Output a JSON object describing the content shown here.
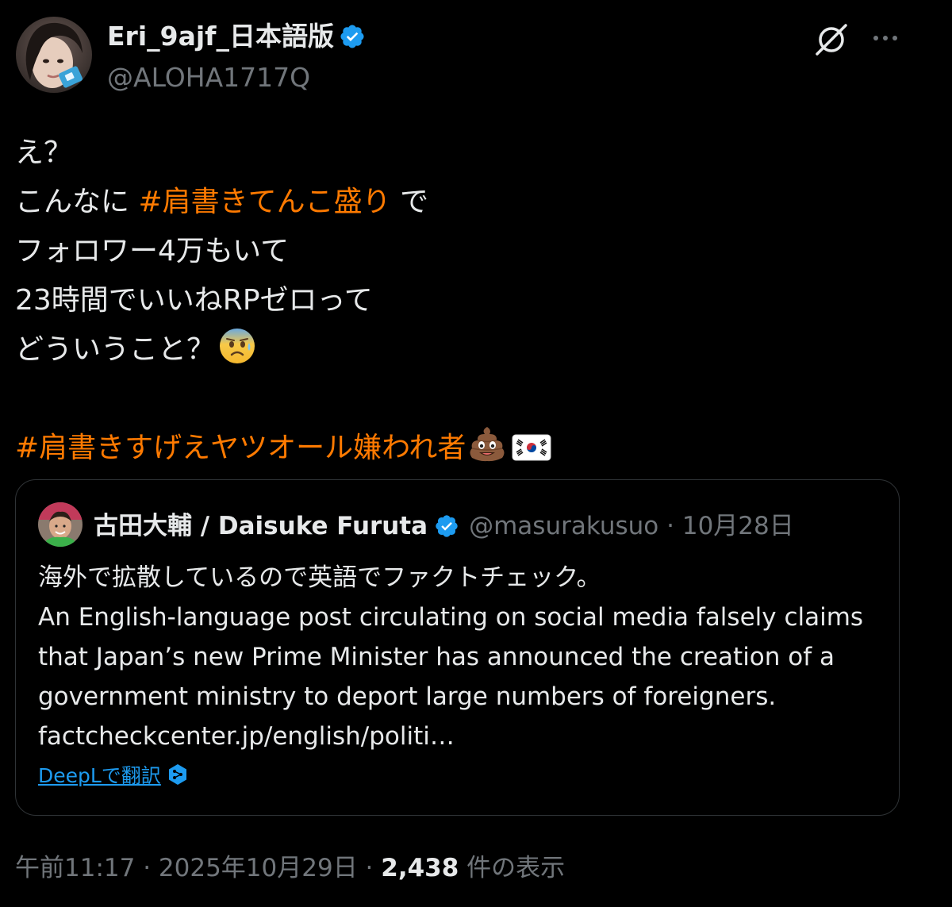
{
  "author": {
    "display_name": "Eri_9ajf_日本語版",
    "handle": "@ALOHA1717Q",
    "verified": true
  },
  "tweet": {
    "line1": "え？",
    "line2_pre": "こんなに ",
    "line2_hashtag": "#肩書きてんこ盛り",
    "line2_post": " で",
    "line3": "フォロワー4万もいて",
    "line4": "23時間でいいねRPゼロって",
    "line5": "どういうこと？",
    "line5_emoji": "anxious-face",
    "line7_hashtag": "#肩書きすげえヤツオール嫌われ者",
    "line7_emojis": [
      "pile-of-poo",
      "flag-south-korea"
    ]
  },
  "quote": {
    "display_name": "古田大輔 / Daisuke Furuta",
    "handle": "@masurakusuo",
    "separator": "·",
    "date": "10月28日",
    "text_lines": [
      "海外で拡散しているので英語でファクトチェック。",
      "An English-language post circulating on social media falsely claims",
      "that Japan’s new Prime Minister has announced the creation of a",
      "government ministry to deport large numbers of foreigners.",
      "factcheckcenter.jp/english/politi…"
    ],
    "translate_label": "DeepLで翻訳"
  },
  "meta": {
    "time": "午前11:17",
    "sep1": " · ",
    "date": "2025年10月29日",
    "sep2": " · ",
    "views": "2,438",
    "views_suffix": " 件の表示"
  },
  "colors": {
    "background": "#000000",
    "text": "#e7e9ea",
    "secondary": "#71767b",
    "hashtag": "#ff7a00",
    "verified": "#1d9bf0",
    "link": "#1d9bf0",
    "border": "#2f3336"
  }
}
